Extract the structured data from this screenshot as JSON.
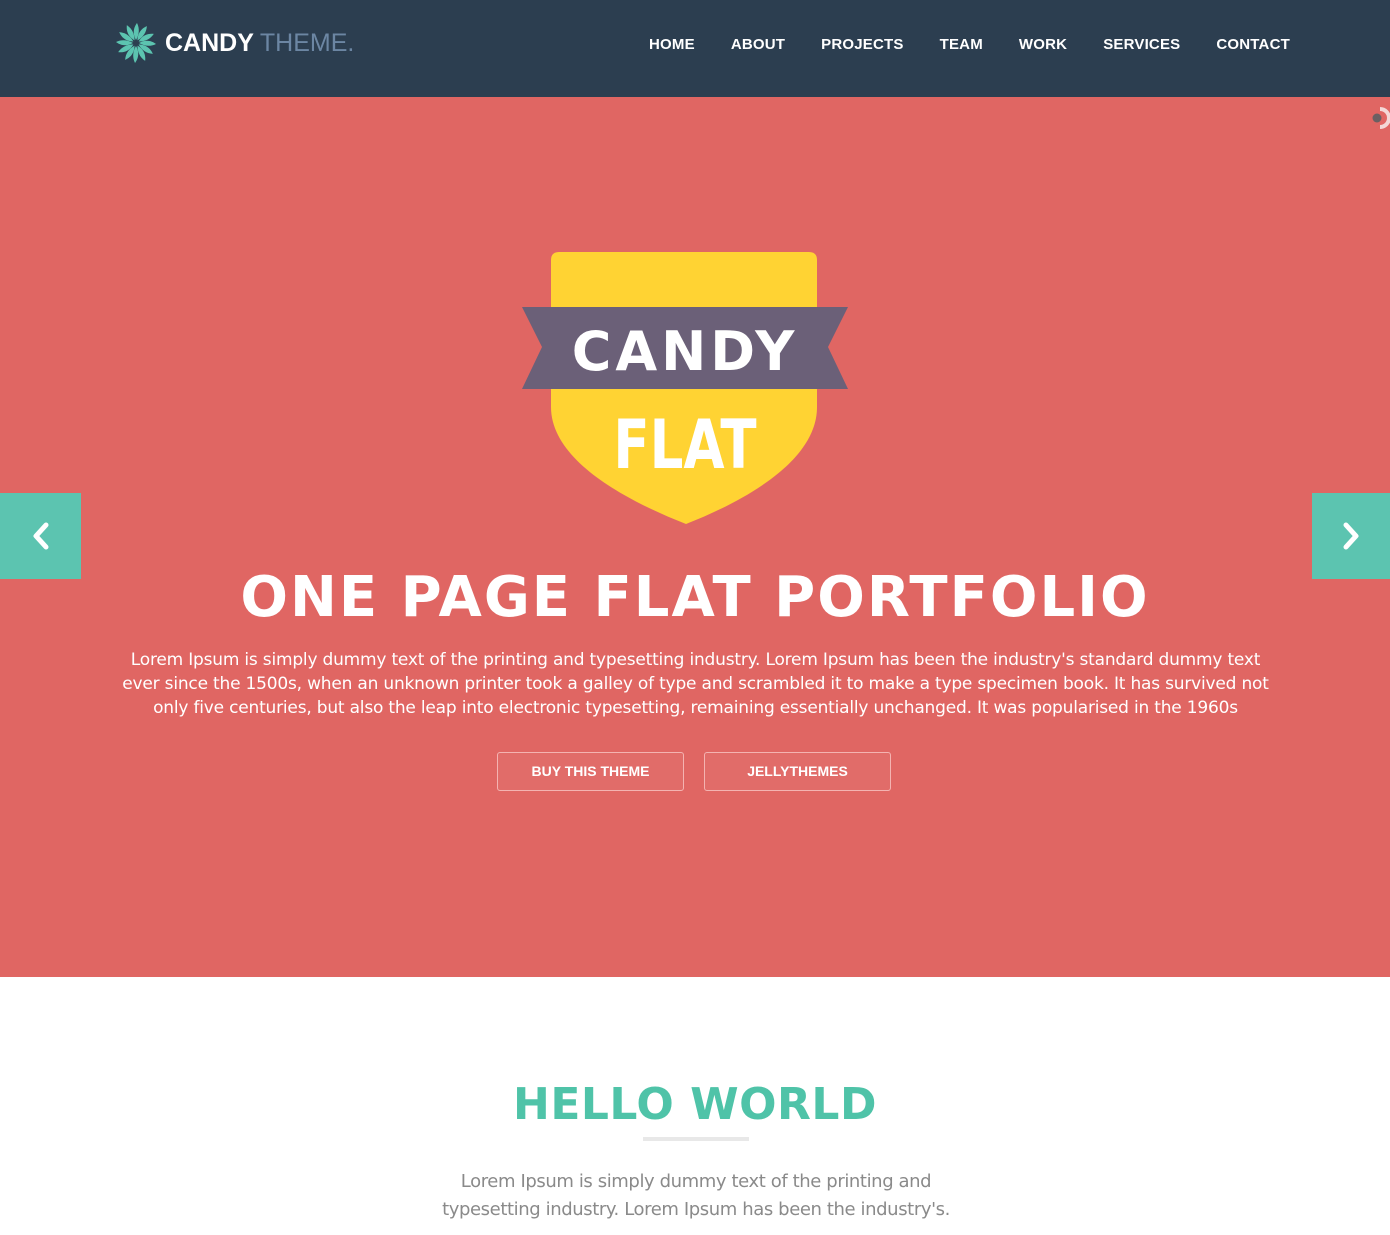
{
  "nav": {
    "logo": {
      "word1": "CANDY",
      "word2": "THEME."
    },
    "items": [
      {
        "label": "HOME"
      },
      {
        "label": "ABOUT"
      },
      {
        "label": "PROJECTS"
      },
      {
        "label": "TEAM"
      },
      {
        "label": "WORK"
      },
      {
        "label": "SERVICES"
      },
      {
        "label": "CONTACT"
      }
    ]
  },
  "hero": {
    "badge": {
      "line1": "CANDY",
      "line2": "FLAT"
    },
    "title": "ONE PAGE FLAT PORTFOLIO",
    "text": "Lorem Ipsum is simply dummy text of the printing and typesetting industry. Lorem Ipsum has been the industry's standard dummy text ever since the 1500s, when an unknown printer took a galley of type and scrambled it to make a type specimen book. It has survived not only five centuries, but also the leap into electronic typesetting, remaining essentially unchanged. It was popularised in the 1960s",
    "buttons": {
      "buy": "BUY THIS THEME",
      "jelly": "JELLYTHEMES"
    }
  },
  "about": {
    "title": "HELLO WORLD",
    "text": "Lorem Ipsum is simply dummy text of the printing and typesetting industry. Lorem Ipsum has been the industry's."
  },
  "icons": {
    "logo": "pinwheel-icon",
    "prev": "chevron-left-icon",
    "next": "chevron-right-icon",
    "loader": "loader-icon"
  },
  "colors": {
    "navbar": "#2c3e50",
    "hero_bg": "#e06663",
    "accent": "#5cc4b0",
    "heading": "#4fc3a8",
    "badge_yellow": "#ffd333",
    "badge_ribbon": "#6b6078",
    "logo_word2": "#6c86a3"
  }
}
